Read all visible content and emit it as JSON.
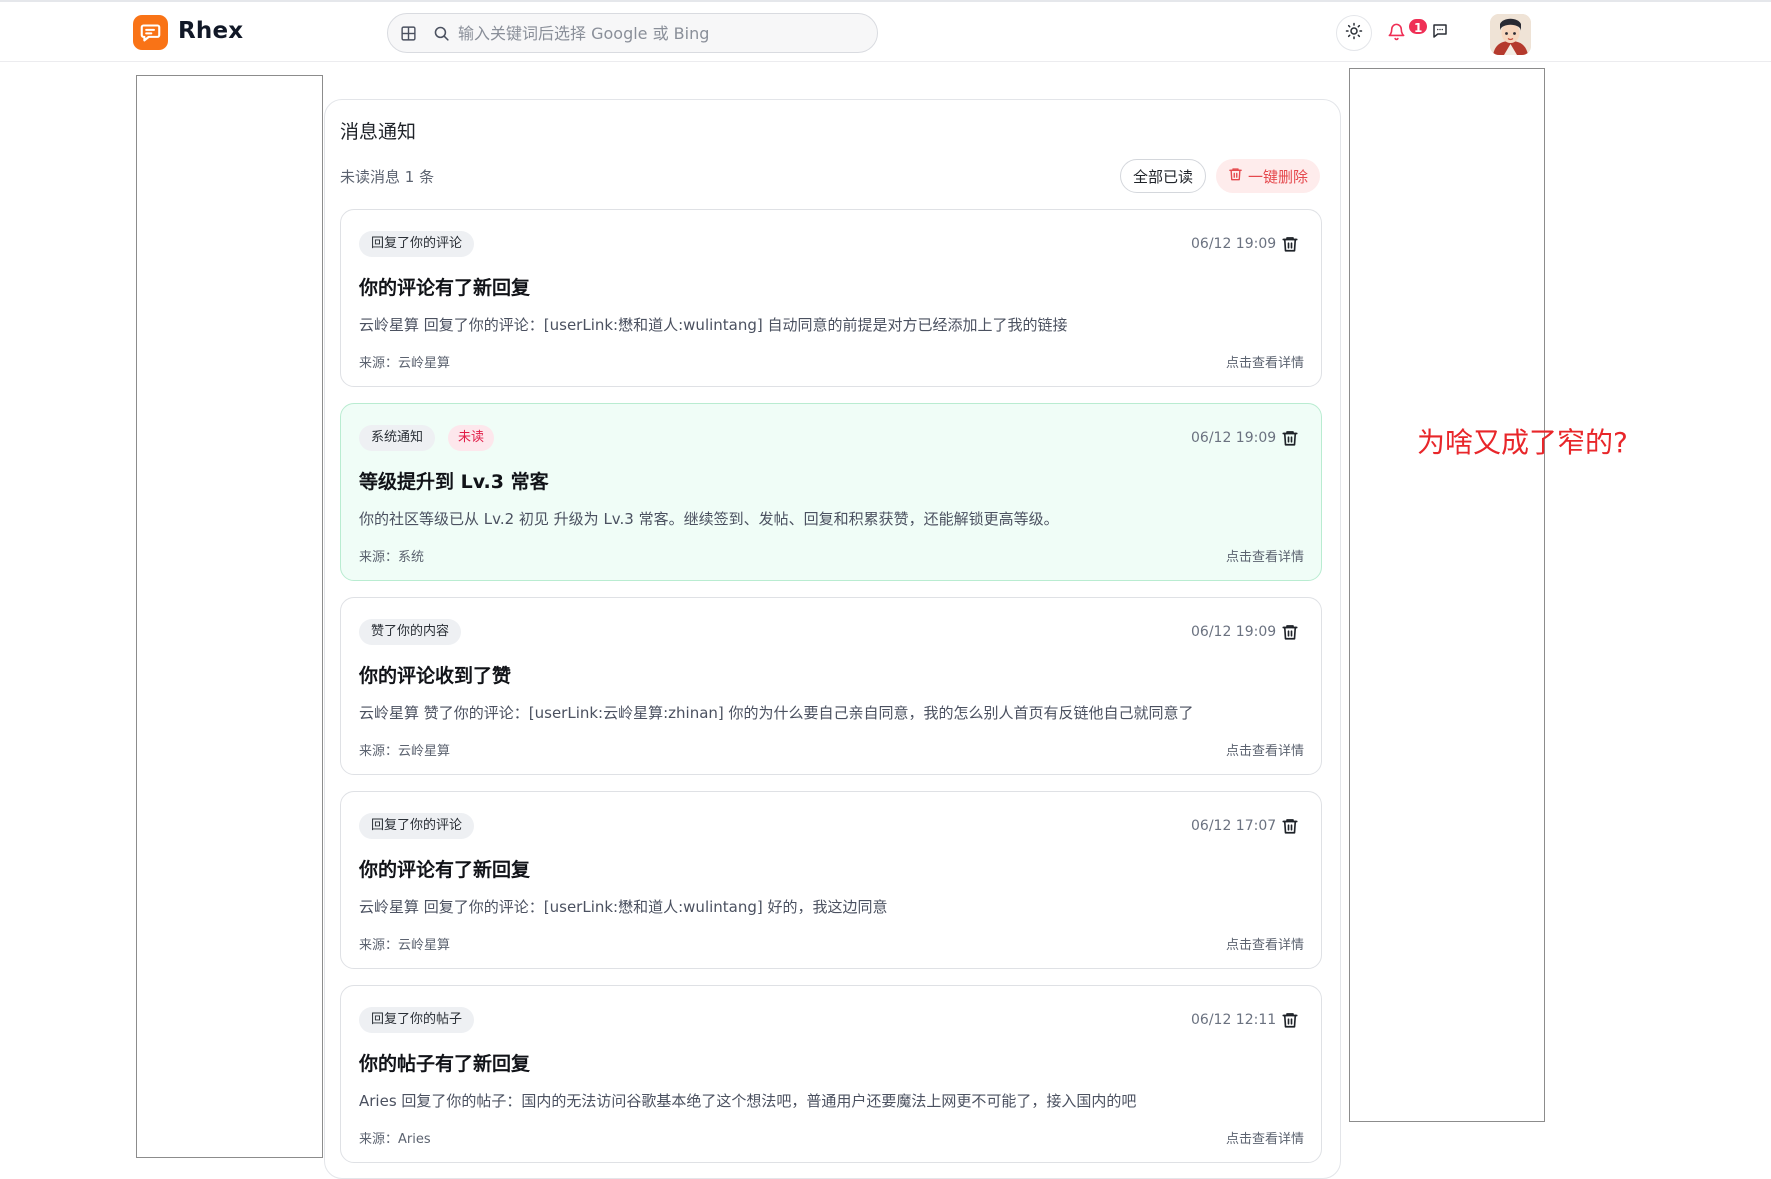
{
  "header": {
    "brand": "Rhex",
    "search_placeholder": "输入关键词后选择 Google 或 Bing",
    "notification_count": "1"
  },
  "main": {
    "title": "消息通知",
    "unread_summary": "未读消息 1 条",
    "mark_all_read": "全部已读",
    "delete_all": "一键删除",
    "notifications": [
      {
        "tag": "回复了你的评论",
        "unread": false,
        "time": "06/12 19:09",
        "title": "你的评论有了新回复",
        "body": "云岭星算 回复了你的评论：[userLink:懋和道人:wulintang] 自动同意的前提是对方已经添加上了我的链接",
        "source": "来源：云岭星算",
        "detail": "点击查看详情"
      },
      {
        "tag": "系统通知",
        "unread": true,
        "unread_label": "未读",
        "time": "06/12 19:09",
        "title": "等级提升到 Lv.3 常客",
        "body": "你的社区等级已从 Lv.2 初见 升级为 Lv.3 常客。继续签到、发帖、回复和积累获赞，还能解锁更高等级。",
        "source": "来源：系统",
        "detail": "点击查看详情"
      },
      {
        "tag": "赞了你的内容",
        "unread": false,
        "time": "06/12 19:09",
        "title": "你的评论收到了赞",
        "body": "云岭星算 赞了你的评论：[userLink:云岭星算:zhinan] 你的为什么要自己亲自同意，我的怎么别人首页有反链他自己就同意了",
        "source": "来源：云岭星算",
        "detail": "点击查看详情"
      },
      {
        "tag": "回复了你的评论",
        "unread": false,
        "time": "06/12 17:07",
        "title": "你的评论有了新回复",
        "body": "云岭星算 回复了你的评论：[userLink:懋和道人:wulintang] 好的，我这边同意",
        "source": "来源：云岭星算",
        "detail": "点击查看详情"
      },
      {
        "tag": "回复了你的帖子",
        "unread": false,
        "time": "06/12 12:11",
        "title": "你的帖子有了新回复",
        "body": "Aries 回复了你的帖子：国内的无法访问谷歌基本绝了这个想法吧，普通用户还要魔法上网更不可能了，接入国内的吧",
        "source": "来源：Aries",
        "detail": "点击查看详情"
      }
    ]
  },
  "annotation": "为啥又成了窄的?",
  "colors": {
    "brand": "#f97316",
    "badge": "#ef2f55",
    "danger": "#e5484d",
    "unread_bg": "#f0fdf7",
    "annotation": "#e8262a"
  }
}
